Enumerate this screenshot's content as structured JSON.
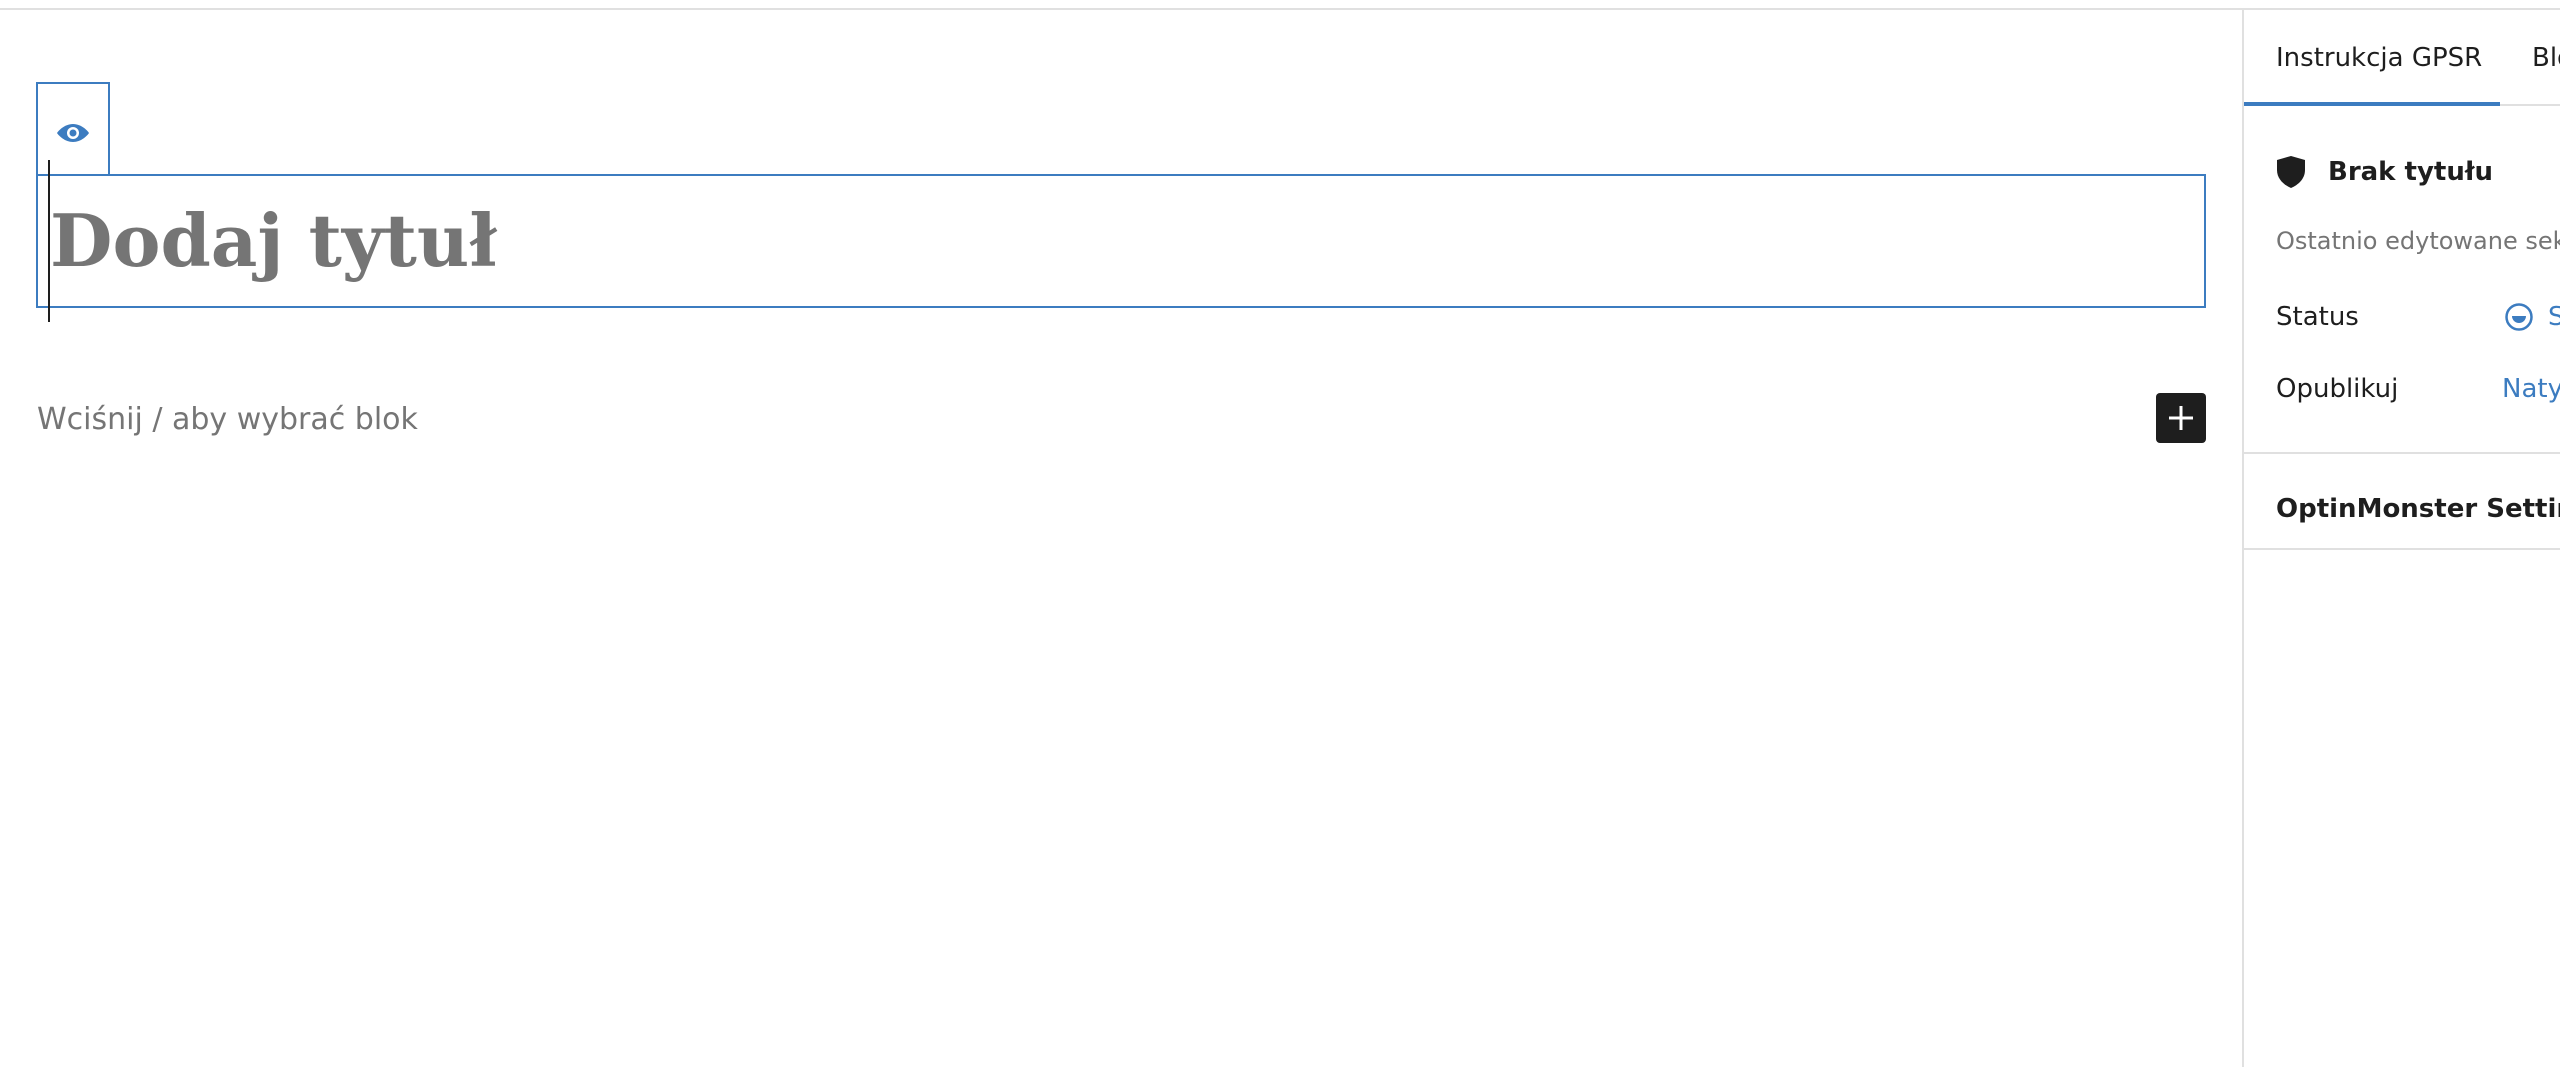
{
  "editor": {
    "title_placeholder": "Dodaj tytuł",
    "block_placeholder": "Wciśnij / aby wybrać blok",
    "visibility_icon": "eye-icon",
    "add_block_icon": "plus-icon"
  },
  "sidebar": {
    "tabs": [
      {
        "label": "Instrukcja GPSR",
        "active": true
      },
      {
        "label": "Blok",
        "active": false
      }
    ],
    "post_panel": {
      "icon": "shield-icon",
      "title": "Brak tytułu",
      "last_edited": "Ostatnio edytowane sek"
    },
    "rows": [
      {
        "label": "Status",
        "value": "S",
        "icon": "status-circle-icon"
      },
      {
        "label": "Opublikuj",
        "value": "Naty"
      }
    ],
    "optinmonster": {
      "title": "OptinMonster Settings"
    }
  },
  "colors": {
    "accent": "#3c7cc0",
    "text": "#1e1e1e",
    "muted": "#757575",
    "border": "#e0e0e0"
  }
}
